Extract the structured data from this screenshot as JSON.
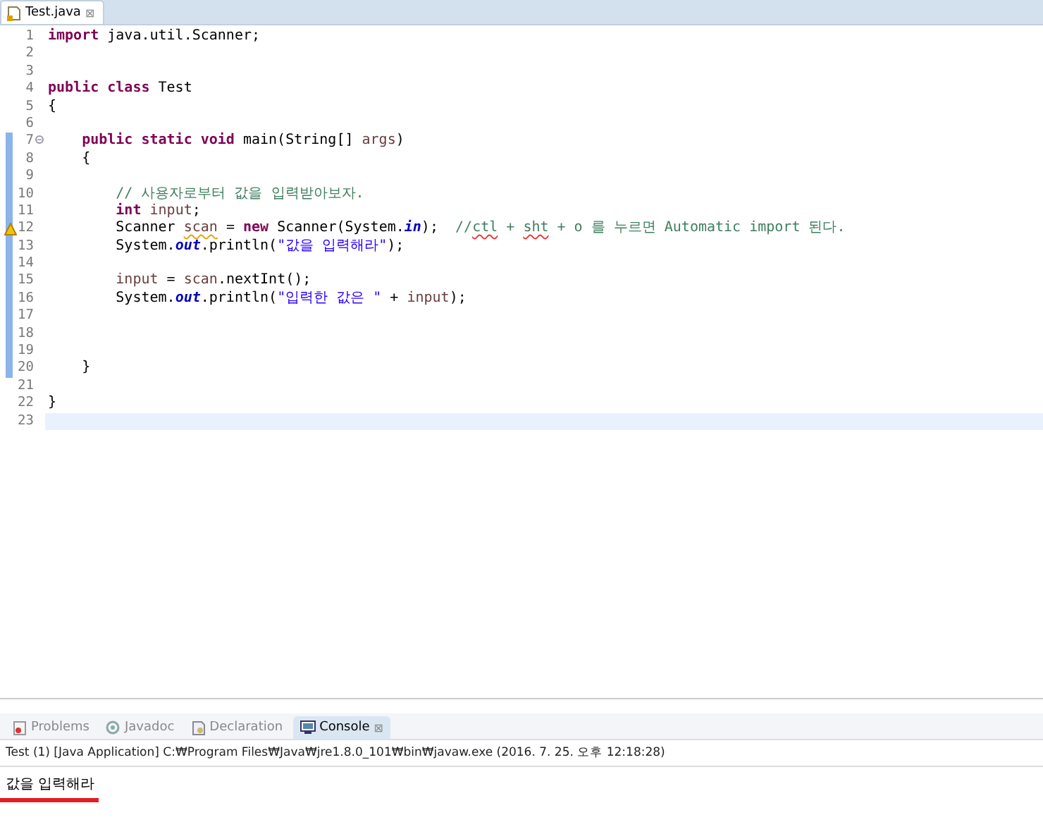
{
  "editor_tabs": [
    {
      "label": "Test.java",
      "selected": true,
      "close": "⊠"
    }
  ],
  "lines": [
    {
      "number": "1",
      "tokens": [
        {
          "kind": "keyword",
          "text": "import"
        },
        {
          "kind": "plain",
          "text": " java.util.Scanner;"
        }
      ]
    },
    {
      "number": "2"
    },
    {
      "number": "3"
    },
    {
      "number": "4",
      "tokens": [
        {
          "kind": "keyword",
          "text": "public class"
        },
        {
          "kind": "plain",
          "text": " Test"
        }
      ]
    },
    {
      "number": "5",
      "tokens": [
        {
          "kind": "plain",
          "text": "{"
        }
      ]
    },
    {
      "number": "6"
    },
    {
      "number": "7",
      "marked": true,
      "fold": true,
      "tokens": [
        {
          "kind": "keyword",
          "text": "    public static void"
        },
        {
          "kind": "plain",
          "text": " main(String[] "
        },
        {
          "kind": "local",
          "text": "args"
        },
        {
          "kind": "plain",
          "text": ")"
        }
      ]
    },
    {
      "number": "8",
      "marked": true,
      "tokens": [
        {
          "kind": "plain",
          "text": "    {"
        }
      ]
    },
    {
      "number": "9",
      "marked": true
    },
    {
      "number": "10",
      "marked": true,
      "tokens": [
        {
          "kind": "comment",
          "text": "        // 사용자로부터 값을 입력받아보자."
        }
      ]
    },
    {
      "number": "11",
      "marked": true,
      "tokens": [
        {
          "kind": "keyword",
          "text": "        int"
        },
        {
          "kind": "local",
          "text": " input"
        },
        {
          "kind": "plain",
          "text": ";"
        }
      ]
    },
    {
      "number": "12",
      "marked": true,
      "warning": true,
      "tokens": [
        {
          "kind": "plain",
          "text": "        Scanner "
        },
        {
          "kind": "local_warn",
          "text": "scan"
        },
        {
          "kind": "plain",
          "text": " = "
        },
        {
          "kind": "keyword",
          "text": "new"
        },
        {
          "kind": "plain",
          "text": " Scanner(System."
        },
        {
          "kind": "static_field",
          "text": "in"
        },
        {
          "kind": "plain",
          "text": ");  "
        },
        {
          "kind": "comment",
          "text": "//"
        },
        {
          "kind": "comment_spell",
          "text": "ctl"
        },
        {
          "kind": "comment",
          "text": " + "
        },
        {
          "kind": "comment_spell",
          "text": "sht"
        },
        {
          "kind": "comment",
          "text": " + o 를 누르면 Automatic import 된다."
        }
      ]
    },
    {
      "number": "13",
      "marked": true,
      "tokens": [
        {
          "kind": "plain",
          "text": "        System."
        },
        {
          "kind": "static_field",
          "text": "out"
        },
        {
          "kind": "plain",
          "text": ".println("
        },
        {
          "kind": "string",
          "text": "\"값을 입력해라\""
        },
        {
          "kind": "plain",
          "text": ");"
        }
      ]
    },
    {
      "number": "14",
      "marked": true
    },
    {
      "number": "15",
      "marked": true,
      "tokens": [
        {
          "kind": "local",
          "text": "        input"
        },
        {
          "kind": "plain",
          "text": " = "
        },
        {
          "kind": "local",
          "text": "scan"
        },
        {
          "kind": "plain",
          "text": ".nextInt();"
        }
      ]
    },
    {
      "number": "16",
      "marked": true,
      "tokens": [
        {
          "kind": "plain",
          "text": "        System."
        },
        {
          "kind": "static_field",
          "text": "out"
        },
        {
          "kind": "plain",
          "text": ".println("
        },
        {
          "kind": "string",
          "text": "\"입력한 값은 \""
        },
        {
          "kind": "plain",
          "text": " + "
        },
        {
          "kind": "local",
          "text": "input"
        },
        {
          "kind": "plain",
          "text": ");"
        }
      ]
    },
    {
      "number": "17",
      "marked": true
    },
    {
      "number": "18",
      "marked": true
    },
    {
      "number": "19",
      "marked": true
    },
    {
      "number": "20",
      "marked": true,
      "tokens": [
        {
          "kind": "plain",
          "text": "    }"
        }
      ]
    },
    {
      "number": "21"
    },
    {
      "number": "22",
      "tokens": [
        {
          "kind": "plain",
          "text": "}"
        }
      ]
    },
    {
      "number": "23",
      "current": true
    }
  ],
  "console_tabs": [
    {
      "label": "Problems",
      "selected": false
    },
    {
      "label": "Javadoc",
      "selected": false
    },
    {
      "label": "Declaration",
      "selected": false
    },
    {
      "label": "Console",
      "selected": true,
      "close": "⊠"
    }
  ],
  "console": {
    "header": "Test (1) [Java Application] C:₩Program Files₩Java₩jre1.8.0_101₩bin₩javaw.exe (2016. 7. 25. 오후 12:18:28)",
    "output": "값을 입력해라",
    "underlined": true
  }
}
